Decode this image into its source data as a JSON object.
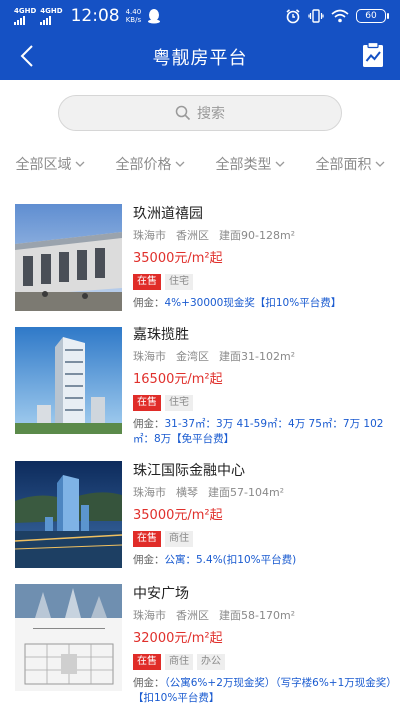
{
  "status_bar": {
    "network1": "4GHD",
    "network2": "4GHD",
    "time": "12:08",
    "speed_value": "4.40",
    "speed_unit": "KB/s",
    "battery": "60",
    "icons": [
      "signal-icon",
      "qq-icon",
      "alarm-icon",
      "vibrate-icon",
      "wifi-icon",
      "battery-icon"
    ]
  },
  "header": {
    "title": "粤靓房平台",
    "back_icon": "back-arrow-icon",
    "action_icon": "clipboard-chart-icon"
  },
  "search": {
    "placeholder": "搜索"
  },
  "filters": [
    {
      "label": "全部区域"
    },
    {
      "label": "全部价格"
    },
    {
      "label": "全部类型"
    },
    {
      "label": "全部面积"
    }
  ],
  "listings": [
    {
      "name": "玖洲道禧园",
      "city": "珠海市",
      "district": "香洲区",
      "area": "建面90-128m²",
      "price": "35000元/m²起",
      "status": "在售",
      "types": [
        "住宅"
      ],
      "commission_label": "佣金：",
      "commission": "4%+30000现金奖【扣10%平台费】"
    },
    {
      "name": "嘉珠揽胜",
      "city": "珠海市",
      "district": "金湾区",
      "area": "建面31-102m²",
      "price": "16500元/m²起",
      "status": "在售",
      "types": [
        "住宅"
      ],
      "commission_label": "佣金：",
      "commission": "31-37㎡：3万 41-59㎡：4万 75㎡：7万 102㎡：8万【免平台费】"
    },
    {
      "name": "珠江国际金融中心",
      "city": "珠海市",
      "district": "横琴",
      "area": "建面57-104m²",
      "price": "35000元/m²起",
      "status": "在售",
      "types": [
        "商住"
      ],
      "commission_label": "佣金：",
      "commission": "公寓：5.4%(扣10%平台费)"
    },
    {
      "name": "中安广场",
      "city": "珠海市",
      "district": "香洲区",
      "area": "建面58-170m²",
      "price": "32000元/m²起",
      "status": "在售",
      "types": [
        "商住",
        "办公"
      ],
      "commission_label": "佣金：",
      "commission": "（公寓6%+2万现金奖）（写字楼6%+1万现金奖）【扣10%平台费】"
    }
  ],
  "colors": {
    "brand": "#1551c4",
    "price": "#e0302c",
    "status_tag": "#e02c28",
    "commission": "#1a5bd0"
  }
}
